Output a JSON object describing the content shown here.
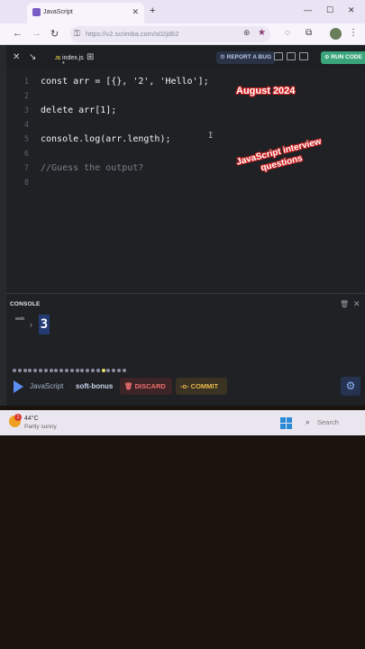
{
  "browser": {
    "tab_title": "JavaScript",
    "tab_close": "✕",
    "new_tab": "+",
    "win_min": "—",
    "win_max": "☐",
    "win_close": "✕",
    "url": "https://v2.scrimba.com/s02jd62",
    "icons": [
      "back-icon",
      "forward-icon",
      "reload-icon",
      "lock-icon",
      "zoom-icon",
      "star-icon",
      "extensions-icon"
    ]
  },
  "editor": {
    "file_tab": "index.js *",
    "file_badge": "JS",
    "report_bug_label": "REPORT A BUG",
    "run_code_label": "RUN CODE",
    "code_lines": [
      {
        "n": "1",
        "text": "const arr = [{}, '2', 'Hello'];",
        "comment": false
      },
      {
        "n": "2",
        "text": "",
        "comment": false
      },
      {
        "n": "3",
        "text": "delete arr[1];",
        "comment": false
      },
      {
        "n": "4",
        "text": "",
        "comment": false
      },
      {
        "n": "5",
        "text": "console.log(arr.length);",
        "comment": false
      },
      {
        "n": "6",
        "text": "",
        "comment": false
      },
      {
        "n": "7",
        "text": "//Guess the output?",
        "comment": true
      },
      {
        "n": "8",
        "text": "",
        "comment": false
      }
    ],
    "cursor_glyph": "I"
  },
  "overlay": {
    "date": "August 2024",
    "caption": "JavaScript interview questions"
  },
  "console": {
    "title": "CONSOLE",
    "source": "web",
    "chevron": "›",
    "output": "3"
  },
  "bottom": {
    "language": "JavaScript",
    "separator": "·",
    "branch": "soft-bonus",
    "discard_label": "DISCARD",
    "commit_label": "COMMIT"
  },
  "taskbar": {
    "temperature": "44°C",
    "condition": "Partly sunny",
    "badge": "1",
    "search_label": "Search"
  },
  "colors": {
    "editor_bg": "#1f2124",
    "run_button": "#3aa57a",
    "discard_text": "#ee6e6e",
    "commit_text": "#e8b84a",
    "console_output_bg": "#243a73"
  }
}
